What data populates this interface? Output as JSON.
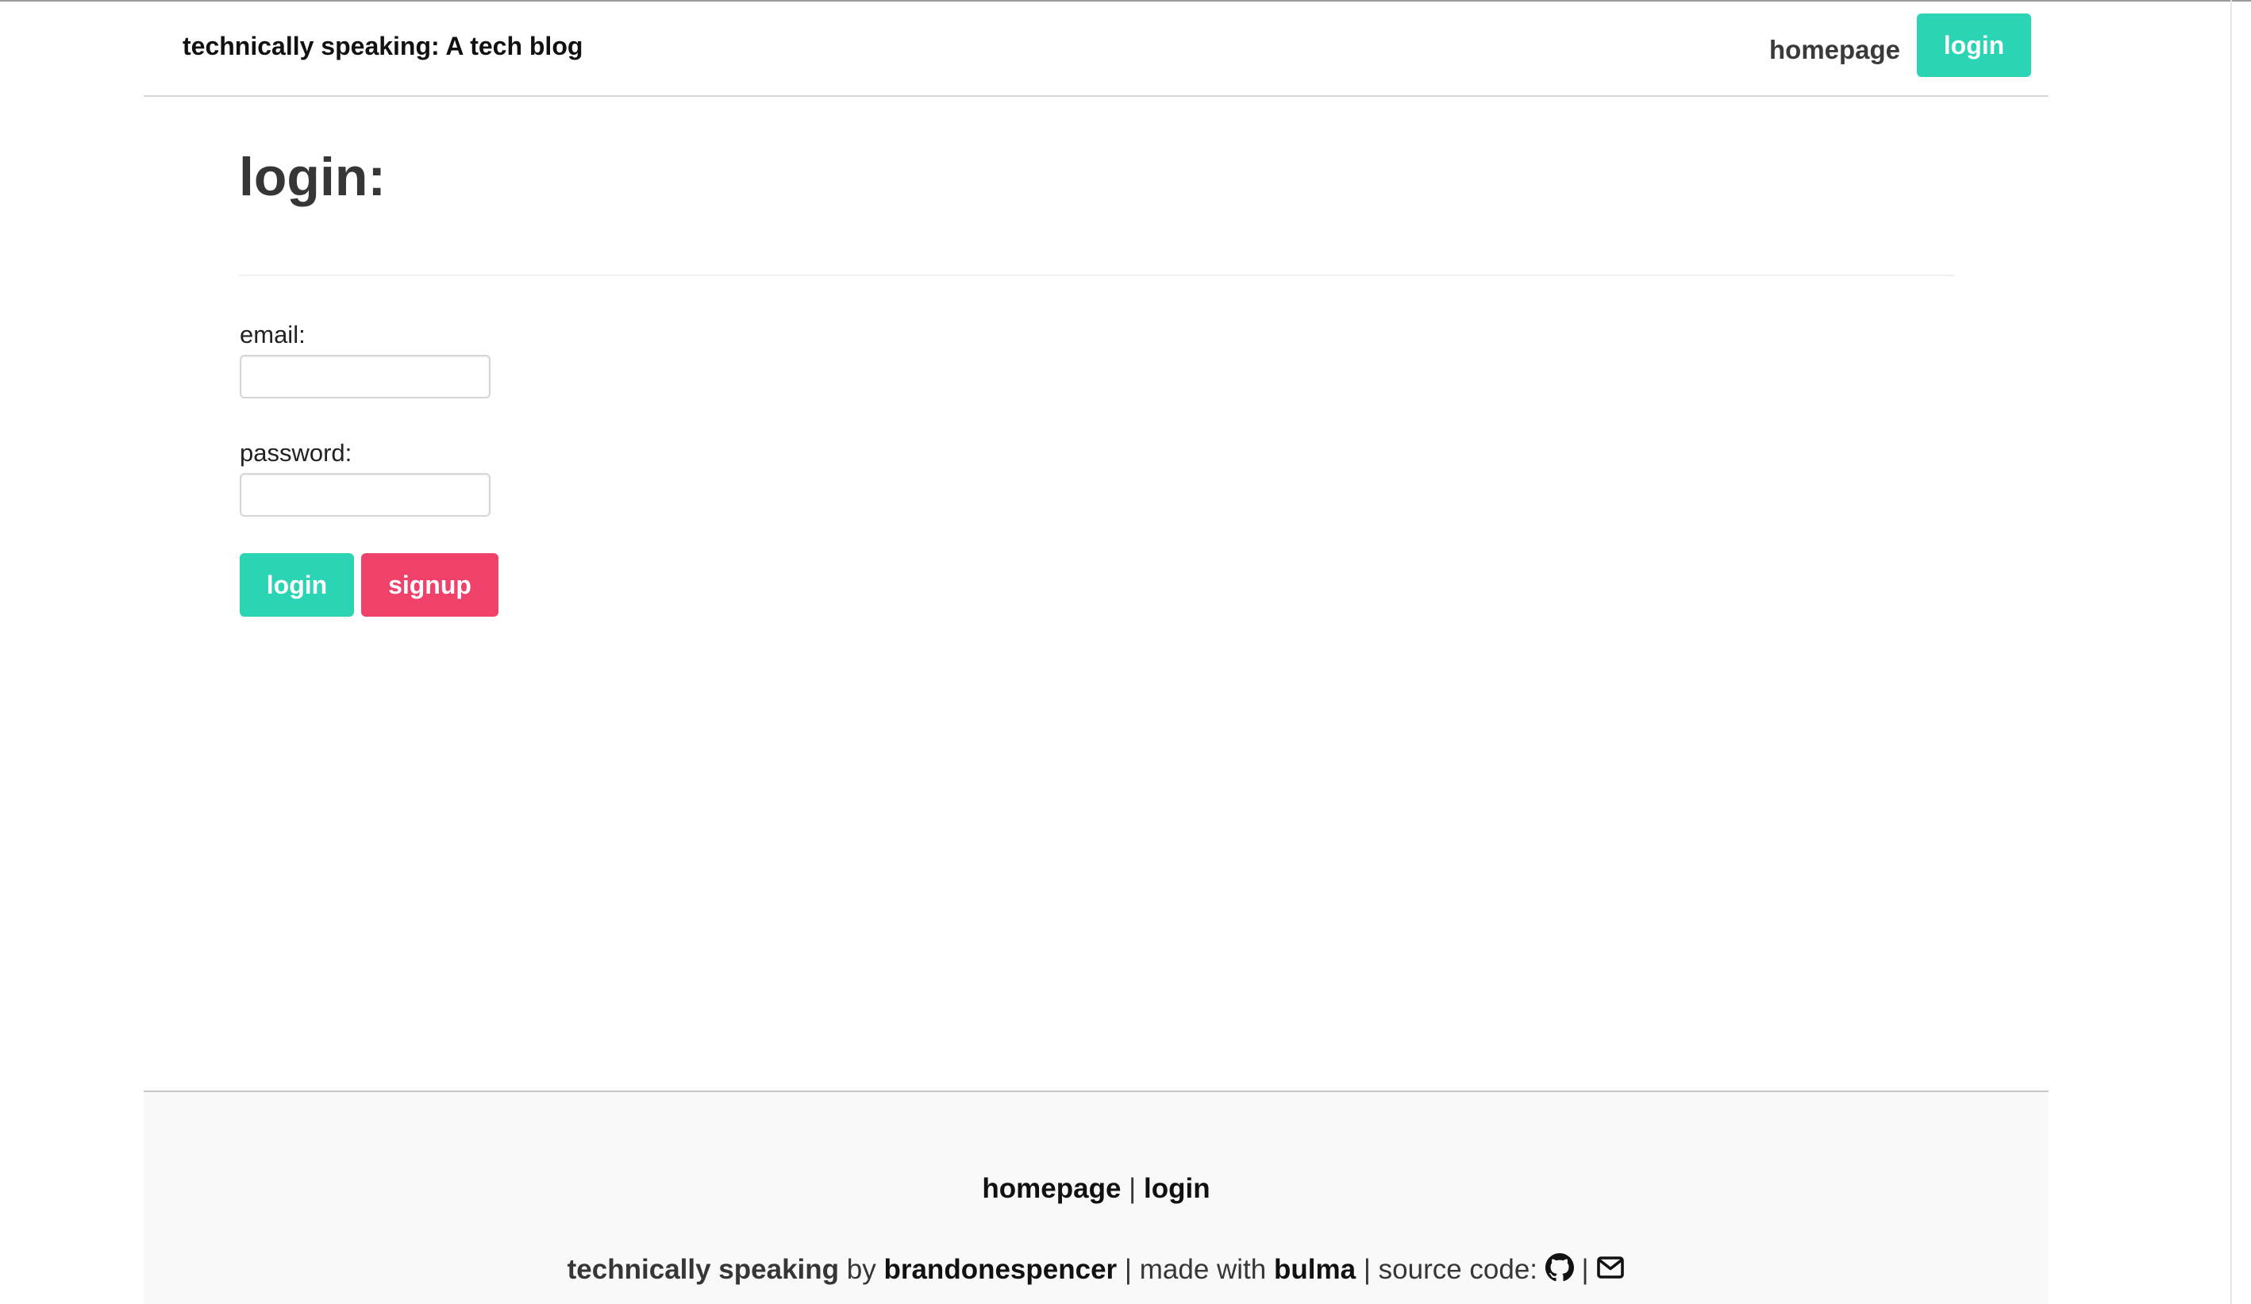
{
  "navbar": {
    "brand": "technically speaking: A tech blog",
    "homepage_label": "homepage",
    "login_label": "login"
  },
  "form": {
    "title": "login:",
    "email_label": "email:",
    "email_value": "",
    "password_label": "password:",
    "password_value": "",
    "login_button": "login",
    "signup_button": "signup"
  },
  "footer": {
    "links": {
      "homepage_label": "homepage",
      "separator": "|",
      "login_label": "login"
    },
    "credits": {
      "site_name": "technically speaking",
      "by_text": "by",
      "author": "brandonespencer",
      "separator": "|",
      "made_with_text": "made with",
      "framework": "bulma",
      "source_code_text": "source code:",
      "github_icon": "github-icon",
      "mail_icon": "envelope-icon"
    }
  },
  "colors": {
    "primary": "#2bd4b4",
    "danger": "#f0416b",
    "footer_background": "#f9f9f9"
  }
}
